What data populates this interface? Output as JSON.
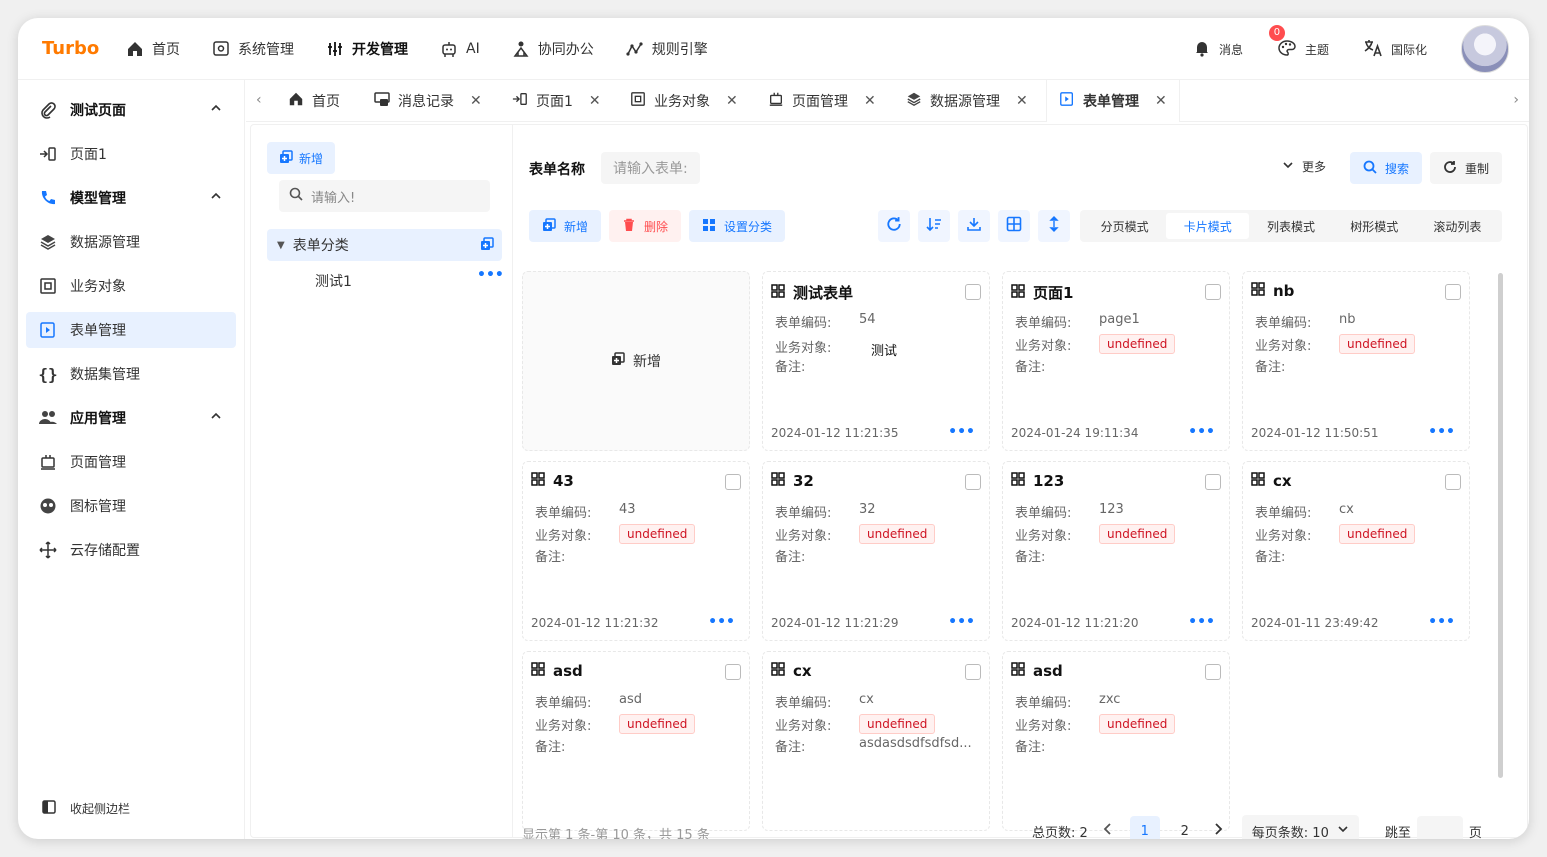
{
  "app": {
    "logo": "Turbo"
  },
  "topnav": [
    {
      "label": "首页",
      "icon": "home-icon"
    },
    {
      "label": "系统管理",
      "icon": "settings-icon"
    },
    {
      "label": "开发管理",
      "icon": "dev-icon",
      "active": true
    },
    {
      "label": "AI",
      "icon": "robot-icon"
    },
    {
      "label": "协同办公",
      "icon": "collab-icon"
    },
    {
      "label": "规则引擎",
      "icon": "rule-icon"
    }
  ],
  "topright": {
    "messages_label": "消息",
    "messages_badge": "0",
    "theme_label": "主题",
    "i18n_label": "国际化"
  },
  "sidebar": {
    "items": [
      {
        "label": "测试页面",
        "type": "group"
      },
      {
        "label": "页面1",
        "type": "item"
      },
      {
        "label": "模型管理",
        "type": "group"
      },
      {
        "label": "数据源管理",
        "type": "item"
      },
      {
        "label": "业务对象",
        "type": "item"
      },
      {
        "label": "表单管理",
        "type": "item",
        "active": true
      },
      {
        "label": "数据集管理",
        "type": "item"
      },
      {
        "label": "应用管理",
        "type": "group"
      },
      {
        "label": "页面管理",
        "type": "item"
      },
      {
        "label": "图标管理",
        "type": "item"
      },
      {
        "label": "云存储配置",
        "type": "item"
      }
    ],
    "collapse_label": "收起侧边栏"
  },
  "tabs": [
    {
      "label": "首页",
      "closable": false
    },
    {
      "label": "消息记录",
      "closable": true
    },
    {
      "label": "页面1",
      "closable": true
    },
    {
      "label": "业务对象",
      "closable": true
    },
    {
      "label": "页面管理",
      "closable": true
    },
    {
      "label": "数据源管理",
      "closable": true
    },
    {
      "label": "表单管理",
      "closable": true,
      "active": true
    }
  ],
  "tree": {
    "add_label": "新增",
    "search_placeholder": "请输入!",
    "root_label": "表单分类",
    "leaf_label": "测试1"
  },
  "filter": {
    "label": "表单名称",
    "placeholder": "请输入表单:",
    "more_label": "更多",
    "search_label": "搜索",
    "reset_label": "重制"
  },
  "toolbar": {
    "add_label": "新增",
    "delete_label": "删除",
    "category_label": "设置分类",
    "modes": [
      "分页模式",
      "卡片模式",
      "列表模式",
      "树形模式",
      "滚动列表"
    ],
    "active_mode": "卡片模式"
  },
  "card_labels": {
    "add": "新增",
    "code": "表单编码:",
    "object": "业务对象:",
    "remark": "备注:"
  },
  "cards": [
    {
      "title": "测试表单",
      "code": "54",
      "object": "测试",
      "object_tag": false,
      "remark": "",
      "date": "2024-01-12 11:21:35"
    },
    {
      "title": "页面1",
      "code": "page1",
      "object": "undefined",
      "object_tag": true,
      "remark": "",
      "date": "2024-01-24 19:11:34"
    },
    {
      "title": "nb",
      "code": "nb",
      "object": "undefined",
      "object_tag": true,
      "remark": "",
      "date": "2024-01-12 11:50:51"
    },
    {
      "title": "43",
      "code": "43",
      "object": "undefined",
      "object_tag": true,
      "remark": "",
      "date": "2024-01-12 11:21:32"
    },
    {
      "title": "32",
      "code": "32",
      "object": "undefined",
      "object_tag": true,
      "remark": "",
      "date": "2024-01-12 11:21:29"
    },
    {
      "title": "123",
      "code": "123",
      "object": "undefined",
      "object_tag": true,
      "remark": "",
      "date": "2024-01-12 11:21:20"
    },
    {
      "title": "cx",
      "code": "cx",
      "object": "undefined",
      "object_tag": true,
      "remark": "",
      "date": "2024-01-11 23:49:42"
    },
    {
      "title": "asd",
      "code": "asd",
      "object": "undefined",
      "object_tag": true,
      "remark": "",
      "date": ""
    },
    {
      "title": "cx",
      "code": "cx",
      "object": "undefined",
      "object_tag": true,
      "remark": "asdasdsdfsdfsd...",
      "date": ""
    },
    {
      "title": "asd",
      "code": "zxc",
      "object": "undefined",
      "object_tag": true,
      "remark": "",
      "date": ""
    }
  ],
  "pagination": {
    "info": "显示第 1 条-第 10 条，共 15 条",
    "total_pages_label": "总页数: 2",
    "pages": [
      "1",
      "2"
    ],
    "current": "1",
    "page_size_label": "每页条数: 10",
    "jump_label": "跳至",
    "page_suffix": "页"
  },
  "colors": {
    "brand": "#ff7a00",
    "primary": "#1677ff",
    "danger": "#ff4d4f"
  }
}
